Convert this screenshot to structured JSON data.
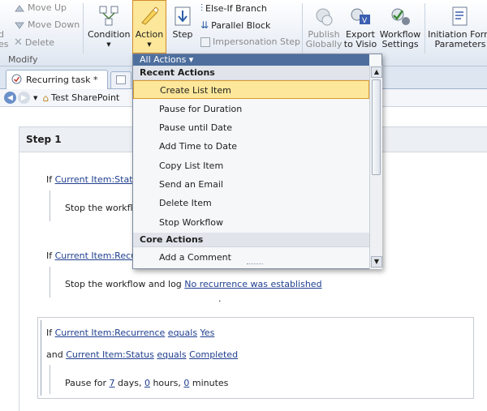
{
  "ribbon": {
    "move_up": "Move Up",
    "move_down": "Move Down",
    "delete": "Delete",
    "left_cut_1": "d",
    "left_cut_2": "es",
    "group_label": "Modify",
    "condition": "Condition",
    "action": "Action",
    "step": "Step",
    "else_if_branch": "Else-If Branch",
    "parallel_block": "Parallel Block",
    "impersonation_step": "Impersonation Step",
    "publish_globally_1": "Publish",
    "publish_globally_2": "Globally",
    "export_visio_1": "Export",
    "export_visio_2": "to Visio",
    "workflow_settings_1": "Workflow",
    "workflow_settings_2": "Settings",
    "initiation_form_1": "Initiation Form",
    "initiation_form_2": "Parameters"
  },
  "tabs": {
    "active_tab": "Recurring task *"
  },
  "breadcrumb": {
    "site": "Test SharePoint"
  },
  "dropdown": {
    "header": "All Actions ▾",
    "recent_category": "Recent Actions",
    "core_category": "Core Actions",
    "items": [
      "Create List Item",
      "Pause for Duration",
      "Pause until Date",
      "Add Time to Date",
      "Copy List Item",
      "Send an Email",
      "Delete Item",
      "Stop Workflow"
    ],
    "core_items": [
      "Add a Comment"
    ],
    "selected_index": 0
  },
  "workflow": {
    "step_title": "Step 1",
    "block1_if": "If",
    "block1_field": "Current Item:Status",
    "block1_action": "Stop the workflo",
    "block2_if": "If",
    "block2_field": "Current Item:Recur",
    "block2_action_prefix": "Stop the workflow and log",
    "block2_action_link": "No recurrence was established",
    "block2_dot": ".",
    "block3_if": "If",
    "block3_field": "Current Item:Recurrence",
    "block3_op": "equals",
    "block3_value": "Yes",
    "block3_and": "and",
    "block3_field2": "Current Item:Status",
    "block3_op2": "equals",
    "block3_value2": "Completed",
    "pause_prefix": "Pause for",
    "pause_days": "7",
    "pause_days_label": "days,",
    "pause_hours": "0",
    "pause_hours_label": "hours,",
    "pause_minutes": "0",
    "pause_minutes_label": "minutes"
  },
  "colors": {
    "action_highlight": "#fde79a",
    "menu_header": "#4e6f9e",
    "link": "#1f3f8f"
  }
}
